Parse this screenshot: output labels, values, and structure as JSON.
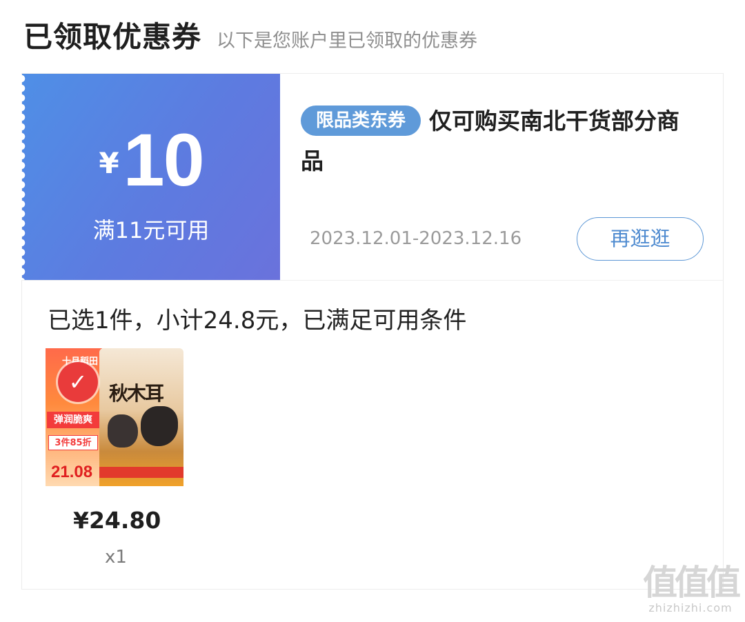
{
  "header": {
    "title": "已领取优惠券",
    "subtitle": "以下是您账户里已领取的优惠券"
  },
  "coupon": {
    "currency_symbol": "¥",
    "amount": "10",
    "threshold": "满11元可用",
    "tag": "限品类东券",
    "description": "仅可购买南北干货部分商品",
    "validity": "2023.12.01-2023.12.16",
    "shop_button": "再逛逛",
    "colors": {
      "gradient_start": "#4f8fe6",
      "gradient_end": "#6a72dc",
      "tag_bg": "#5f9ad9",
      "button_border": "#5b96d5"
    }
  },
  "selection": {
    "summary": "已选1件，小计24.8元，已满足可用条件"
  },
  "product": {
    "image_texts": {
      "brand": "十月稻田",
      "label1": "弹润脆爽",
      "label2": "3件85折",
      "ad_price": "21.08",
      "pack_name": "秋木耳"
    },
    "price": "¥24.80",
    "quantity": "x1",
    "selected": true
  },
  "watermark": {
    "logo": "值值值",
    "url": "zhizhizhi.com"
  }
}
